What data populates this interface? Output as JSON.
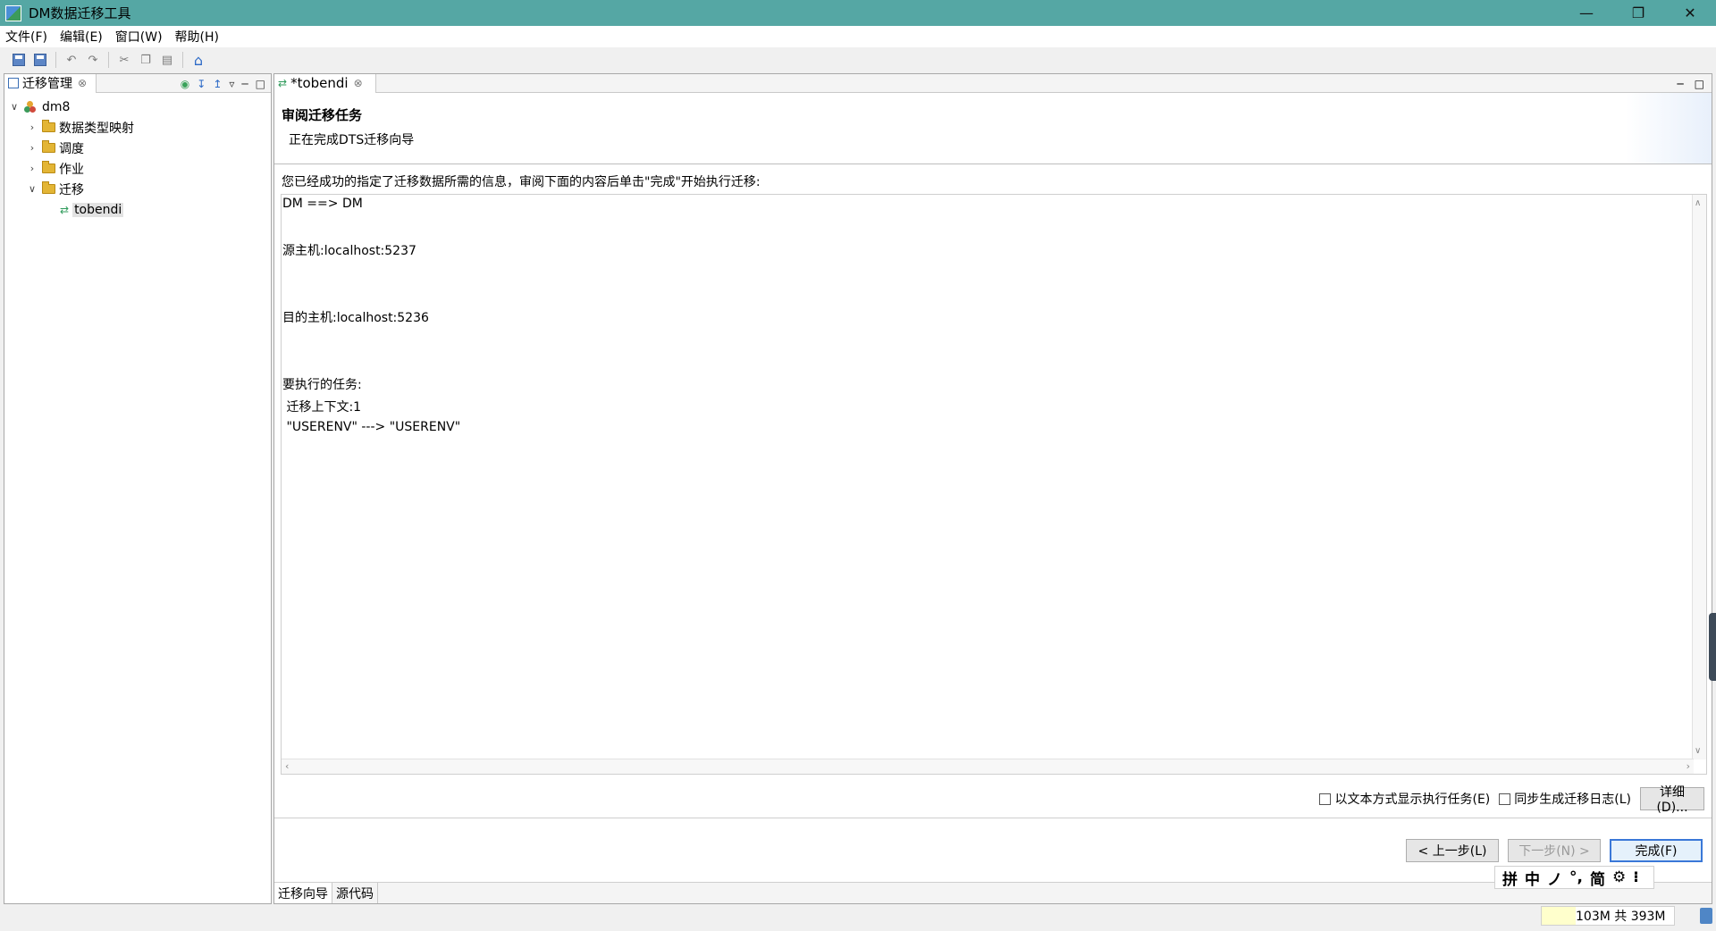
{
  "window": {
    "title": "DM数据迁移工具"
  },
  "menu": [
    "文件(F)",
    "编辑(E)",
    "窗口(W)",
    "帮助(H)"
  ],
  "left_panel": {
    "tab_label": "迁移管理",
    "tree": {
      "root": "dm8",
      "children": [
        "数据类型映射",
        "调度",
        "作业",
        "迁移"
      ],
      "migration_child": "tobendi"
    }
  },
  "editor": {
    "tab_label": "*tobendi",
    "wizard_title": "审阅迁移任务",
    "wizard_subtitle": "正在完成DTS迁移向导",
    "intro": "您已经成功的指定了迁移数据所需的信息，审阅下面的内容后单击\"完成\"开始执行迁移:",
    "summary_lines": [
      "DM ==> DM",
      "源主机:localhost:5237",
      "目的主机:localhost:5236",
      "要执行的任务:",
      " 迁移上下文:1",
      " \"USERENV\" ---> \"USERENV\""
    ],
    "options": {
      "text_mode": "以文本方式显示执行任务(E)",
      "sync_log": "同步生成迁移日志(L)",
      "details": "详细(D)..."
    },
    "nav": {
      "prev": "< 上一步(L)",
      "next": "下一步(N) >",
      "finish": "完成(F)"
    },
    "bottom_tabs": [
      "迁移向导",
      "源代码"
    ]
  },
  "ime": [
    "拼",
    "中",
    "ノ",
    "°,",
    "简",
    "⚙",
    "⁝"
  ],
  "status": {
    "memory": "103M 共 393M",
    "memory_used_fraction": 0.26
  }
}
